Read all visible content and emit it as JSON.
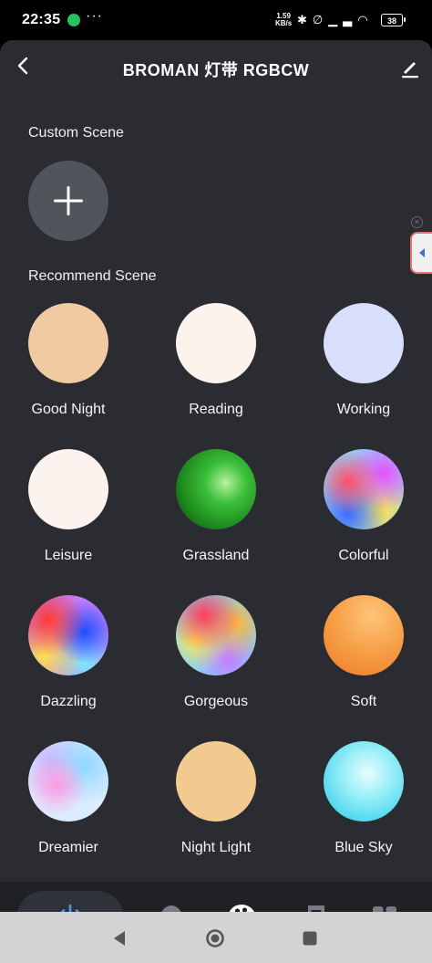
{
  "status_bar": {
    "time": "22:35",
    "more": "···",
    "speed_value": "1.59",
    "speed_unit": "KB/s",
    "battery": "38"
  },
  "header": {
    "title": "BROMAN  灯带 RGBCW"
  },
  "custom_section": {
    "title": "Custom Scene"
  },
  "recommend_section": {
    "title": "Recommend Scene",
    "scenes": [
      {
        "label": "Good Night"
      },
      {
        "label": "Reading"
      },
      {
        "label": "Working"
      },
      {
        "label": "Leisure"
      },
      {
        "label": "Grassland"
      },
      {
        "label": "Colorful"
      },
      {
        "label": "Dazzling"
      },
      {
        "label": "Gorgeous"
      },
      {
        "label": "Soft"
      },
      {
        "label": "Dreamier"
      },
      {
        "label": "Night Light"
      },
      {
        "label": "Blue Sky"
      }
    ]
  },
  "bottom_nav": {
    "items": [
      "power-icon",
      "bulb-icon",
      "palette-icon",
      "music-icon",
      "grid-icon"
    ],
    "active": "power-icon",
    "accent_color": "#4a9be8"
  },
  "colors": {
    "background": "#2a2c31",
    "add_button": "#51545a"
  }
}
